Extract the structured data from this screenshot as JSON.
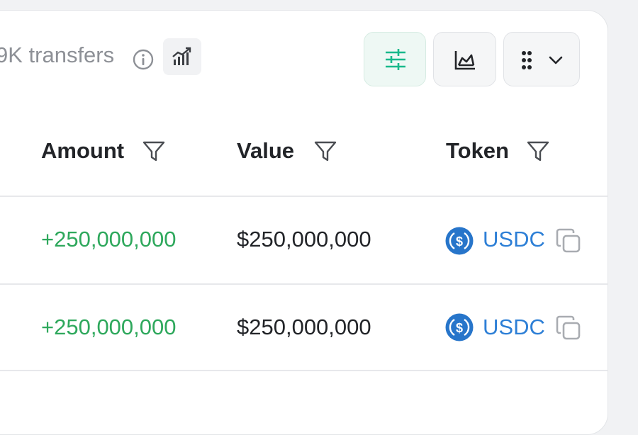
{
  "header": {
    "transfer_count": "9K transfers",
    "icons": [
      "info-icon",
      "chart-icon",
      "sliders-icon",
      "area-chart-icon",
      "grid-icon",
      "chevron-down-icon"
    ]
  },
  "table": {
    "columns": [
      "Amount",
      "Value",
      "Token"
    ],
    "rows": [
      {
        "amount": "+250,000,000",
        "value": "$250,000,000",
        "token": "USDC"
      },
      {
        "amount": "+250,000,000",
        "value": "$250,000,000",
        "token": "USDC"
      }
    ]
  },
  "colors": {
    "positive_amount": "#2ea85c",
    "token_link": "#2d7fd6",
    "active_button": "#19b98b",
    "usdc_icon": "#2775ca"
  }
}
